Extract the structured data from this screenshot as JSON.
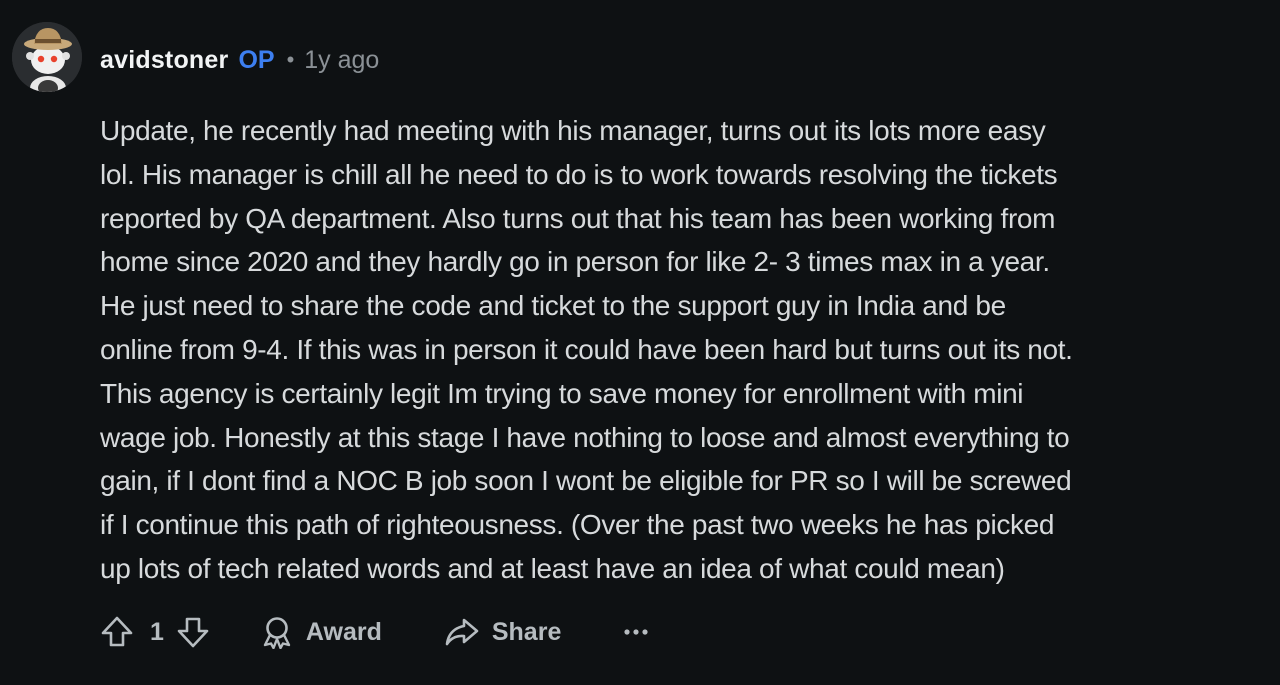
{
  "comment": {
    "author": "avidstoner",
    "op_badge": "OP",
    "separator": "•",
    "timestamp": "1y ago",
    "body_lines": [
      "Update, he recently had meeting with his manager, turns out its lots more easy",
      "lol. His manager is chill all he need to do is to work towards resolving the tickets",
      "reported by QA department. Also turns out that his team has been working from",
      "home since 2020 and they hardly go in person for like 2- 3 times max in a year.",
      "He just need to share the code and ticket to the support guy in India and be",
      "online from 9-4. If this was in person it could have been hard but turns out its not.",
      "This agency is certainly legit Im trying to save money for enrollment with mini",
      "wage job. Honestly at this stage I have nothing to loose and almost everything to",
      "gain, if I dont find a NOC B job soon I wont be eligible for PR so I will be screwed",
      "if I continue this path of righteousness. (Over the past two weeks he has picked",
      "up lots of tech related words and at least have an idea of what could mean)"
    ]
  },
  "actions": {
    "vote_count": "1",
    "award_label": "Award",
    "share_label": "Share",
    "more_icon": "ellipsis-icon"
  },
  "colors": {
    "background": "#0e1113",
    "text": "#d7dadc",
    "op_badge": "#3d7ff0",
    "muted": "#8b9196"
  }
}
